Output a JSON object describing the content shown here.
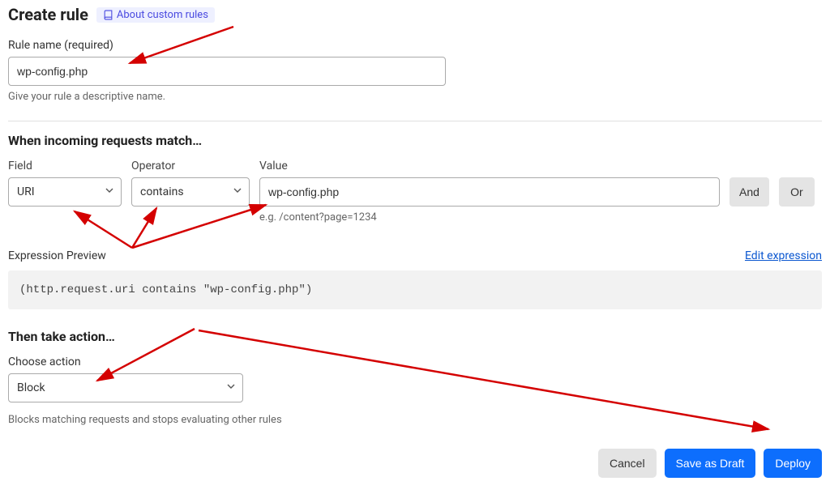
{
  "header": {
    "title": "Create rule",
    "about_label": "About custom rules"
  },
  "rule_name": {
    "label": "Rule name (required)",
    "value": "wp-config.php",
    "help": "Give your rule a descriptive name."
  },
  "match": {
    "section_title": "When incoming requests match…",
    "field_label": "Field",
    "operator_label": "Operator",
    "value_label": "Value",
    "field_value": "URI",
    "operator_value": "contains",
    "value_value": "wp-config.php",
    "value_hint": "e.g. /content?page=1234",
    "and_label": "And",
    "or_label": "Or"
  },
  "preview": {
    "label": "Expression Preview",
    "edit_label": "Edit expression",
    "code": "(http.request.uri contains \"wp-config.php\")"
  },
  "action": {
    "section_title": "Then take action…",
    "choose_label": "Choose action",
    "value": "Block",
    "description": "Blocks matching requests and stops evaluating other rules"
  },
  "footer": {
    "cancel": "Cancel",
    "save_draft": "Save as Draft",
    "deploy": "Deploy"
  }
}
